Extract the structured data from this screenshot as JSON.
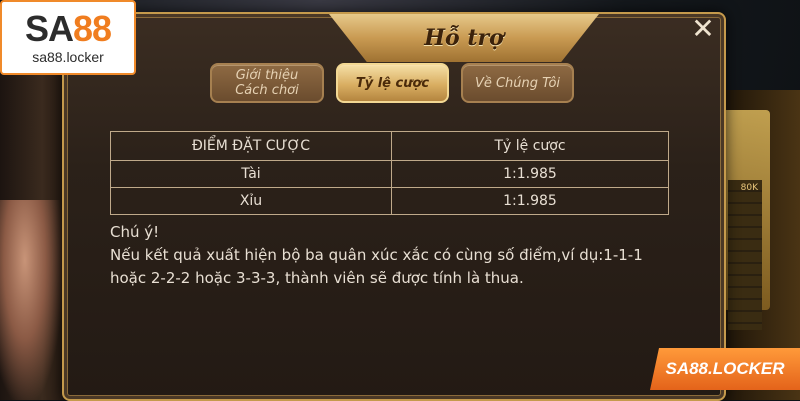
{
  "dialog": {
    "title": "Hỗ trợ",
    "close_glyph": "✕"
  },
  "tabs": [
    {
      "line1": "Giới thiệu",
      "line2": "Cách chơi",
      "active": false
    },
    {
      "label": "Tỷ lệ cược",
      "active": true
    },
    {
      "label": "Về Chúng Tôi",
      "active": false
    }
  ],
  "odds_table": {
    "headers": [
      "ĐIỂM ĐẶT CƯỢC",
      "Tỷ lệ cược"
    ],
    "rows": [
      [
        "Tài",
        "1:1.985"
      ],
      [
        "Xỉu",
        "1:1.985"
      ]
    ]
  },
  "note": {
    "heading": "Chú ý!",
    "body": "Nếu kết quả xuất hiện bộ ba quân xúc xắc có cùng số điểm,ví dụ:1-1-1 hoặc 2-2-2 hoặc 3-3-3, thành viên sẽ được tính là thua."
  },
  "logo": {
    "brand_sa": "SA",
    "brand_num": "88",
    "domain": "sa88.locker"
  },
  "watermark": {
    "text": "SA88.LOCKER"
  },
  "background": {
    "board_label": "80K"
  },
  "colors": {
    "accent_gold": "#c59a4c",
    "logo_orange": "#f07d1f",
    "panel_bg": "#2b2119"
  }
}
